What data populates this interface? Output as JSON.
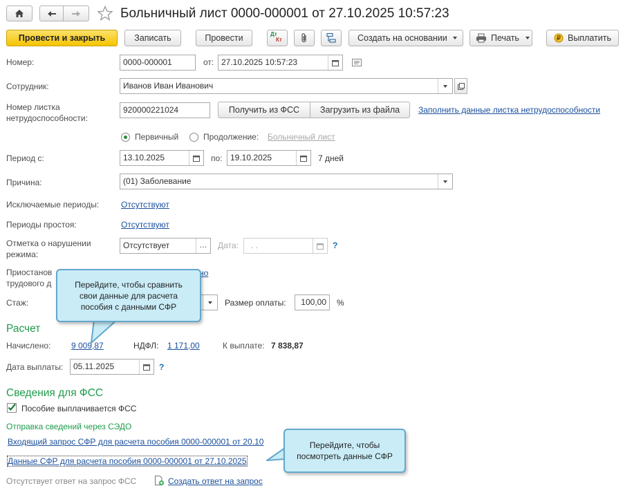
{
  "window": {
    "title": "Больничный лист 0000-000001 от 27.10.2025 10:57:23"
  },
  "toolbar": {
    "post_close": "Провести и закрыть",
    "save": "Записать",
    "post": "Провести",
    "dtkt_top": "Дт",
    "dtkt_bottom": "Кт",
    "create_based": "Создать на основании",
    "print": "Печать",
    "pay": "Выплатить"
  },
  "form": {
    "number_label": "Номер:",
    "number_value": "0000-000001",
    "date_from_label": "от:",
    "date_value": "27.10.2025 10:57:23",
    "employee_label": "Сотрудник:",
    "employee_value": "Иванов Иван Иванович",
    "sick_number_label_1": "Номер листка",
    "sick_number_label_2": "нетрудоспособности:",
    "sick_number_value": "920000221024",
    "get_fss": "Получить из ФСС",
    "load_file": "Загрузить из файла",
    "fill_link": "Заполнить данные листка нетрудоспособности",
    "primary": "Первичный",
    "continuation": "Продолжение:",
    "continuation_link": "Больничный лист",
    "period_label": "Период с:",
    "period_from": "13.10.2025",
    "period_to_label": "по:",
    "period_to": "19.10.2025",
    "days": "7 дней",
    "reason_label": "Причина:",
    "reason_value": "(01) Заболевание",
    "excluded_label": "Исключаемые периоды:",
    "excluded_value": "Отсутствуют",
    "downtime_label": "Периоды простоя:",
    "downtime_value": "Отсутствуют",
    "violation_label_1": "Отметка о нарушении",
    "violation_label_2": "режима:",
    "violation_value": "Отсутствует",
    "violation_date_label": "Дата:",
    "violation_date_value": " .  .",
    "help": "?",
    "suspend_label_1": "Приостанов",
    "suspend_label_2": "трудового д",
    "suspend_link": "но",
    "stazh_label": "Стаж:",
    "pay_size_label": "Размер оплаты:",
    "pay_size_value": "100,00",
    "percent": "%"
  },
  "calc": {
    "title": "Расчет",
    "accrued_label": "Начислено:",
    "accrued_value": "9 009,87",
    "ndfl_label": "НДФЛ:",
    "ndfl_value": "1 171,00",
    "payout_label": "К выплате:",
    "payout_value": "7 838,87",
    "pay_date_label": "Дата выплаты:",
    "pay_date_value": "05.11.2025"
  },
  "fss": {
    "title": "Сведения для ФСС",
    "benefit_checkbox": "Пособие выплачивается ФСС",
    "sedo_title": "Отправка сведений через СЭДО",
    "incoming_link": "Входящий запрос СФР для расчета пособия 0000-000001 от 20.10",
    "data_link": "Данные СФР для расчета пособия 0000-000001 от 27.10.2025",
    "no_answer": "Отсутствует ответ на запрос ФСС",
    "create_answer": "Создать ответ на запрос"
  },
  "tooltips": {
    "compare": "Перейдите, чтобы сравнить свои данные для расчета пособия с данными СФР",
    "view": "Перейдите, чтобы посмотреть данные СФР"
  },
  "colors": {
    "accent_green": "#1e9b4a",
    "link_blue": "#1a4f9c",
    "primary_yellow": "#f5c400",
    "tooltip_bg": "#c9ecf7"
  }
}
